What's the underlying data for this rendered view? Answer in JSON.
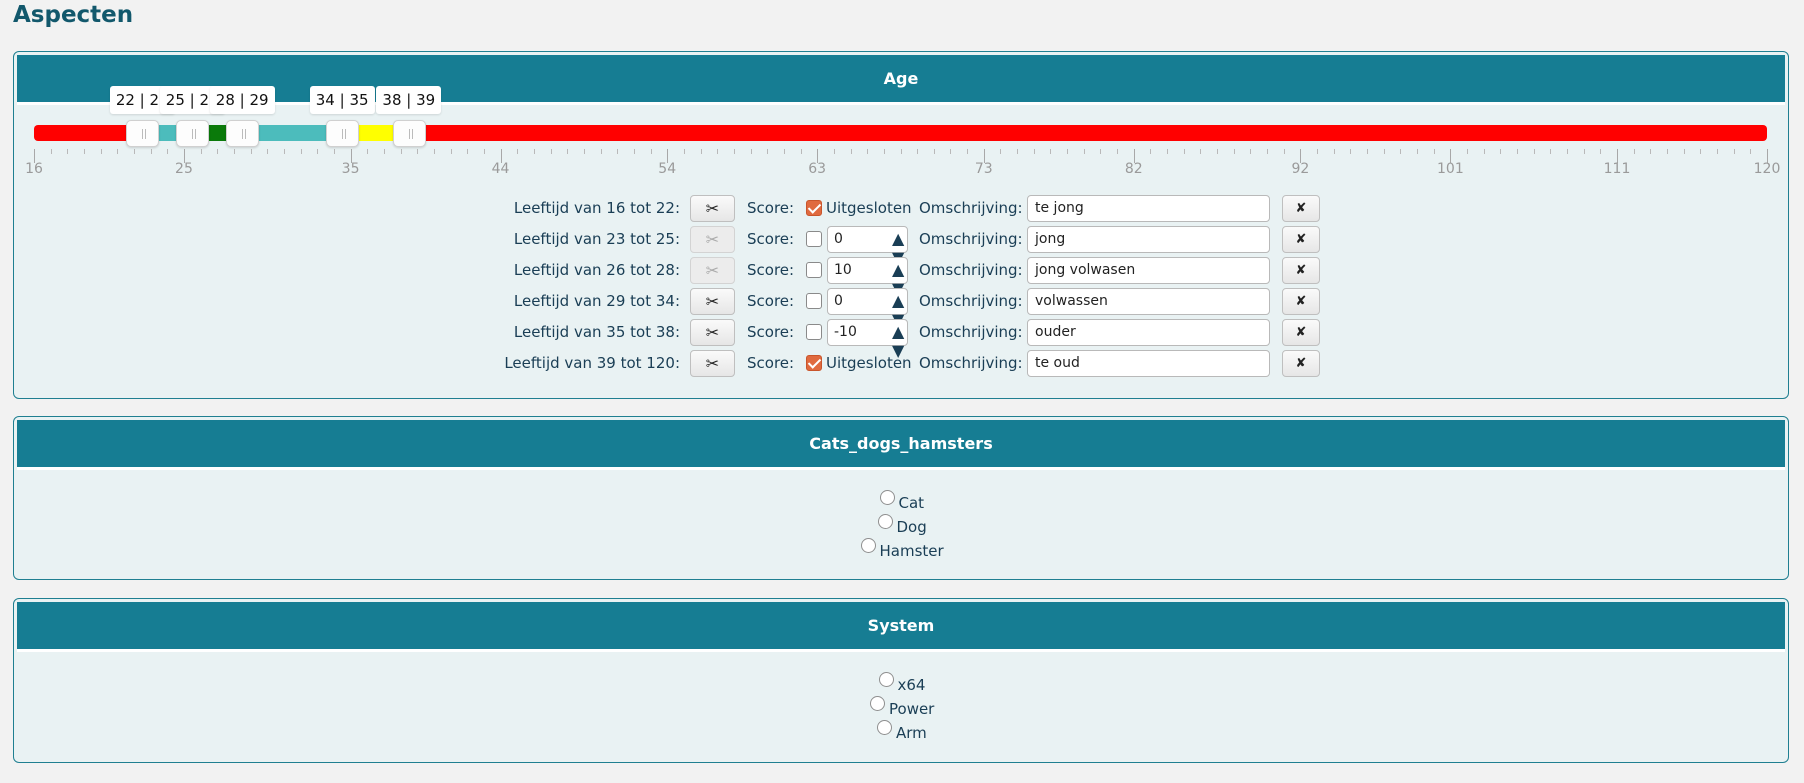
{
  "page": {
    "title": "Aspecten"
  },
  "age": {
    "header": "Age",
    "tooltips": [
      "22 | 23",
      "25 | 26",
      "28 | 29",
      "34 | 35",
      "38 | 39"
    ],
    "axis_labels": [
      "16",
      "25",
      "35",
      "44",
      "54",
      "63",
      "73",
      "82",
      "92",
      "101",
      "111",
      "120"
    ],
    "segments": [
      {
        "from": 16,
        "to": 22,
        "color": "#ff0000"
      },
      {
        "from": 23,
        "to": 25,
        "color": "#4cbcbc"
      },
      {
        "from": 26,
        "to": 28,
        "color": "#0a7a0a"
      },
      {
        "from": 29,
        "to": 34,
        "color": "#4cbcbc"
      },
      {
        "from": 35,
        "to": 38,
        "color": "#ffff00"
      },
      {
        "from": 39,
        "to": 120,
        "color": "#ff0000"
      }
    ],
    "score_label": "Score:",
    "description_label": "Omschrijving:",
    "excluded_label": "Uitgesloten",
    "rows": [
      {
        "range": "Leeftijd van 16 tot 22:",
        "excluded": true,
        "score": "",
        "description": "te jong",
        "split_enabled": true
      },
      {
        "range": "Leeftijd van 23 tot 25:",
        "excluded": false,
        "score": "0",
        "description": "jong",
        "split_enabled": false
      },
      {
        "range": "Leeftijd van 26 tot 28:",
        "excluded": false,
        "score": "10",
        "description": "jong volwasen",
        "split_enabled": false
      },
      {
        "range": "Leeftijd van 29 tot 34:",
        "excluded": false,
        "score": "0",
        "description": "volwassen",
        "split_enabled": true
      },
      {
        "range": "Leeftijd van 35 tot 38:",
        "excluded": false,
        "score": "-10",
        "description": "ouder",
        "split_enabled": true
      },
      {
        "range": "Leeftijd van 39 tot 120:",
        "excluded": true,
        "score": "",
        "description": "te oud",
        "split_enabled": true
      }
    ],
    "split_icon": "scissors-icon",
    "delete_icon": "close-icon"
  },
  "pets": {
    "header": "Cats_dogs_hamsters",
    "options": [
      "Cat",
      "Dog",
      "Hamster"
    ]
  },
  "system": {
    "header": "System",
    "options": [
      "x64",
      "Power",
      "Arm"
    ]
  }
}
